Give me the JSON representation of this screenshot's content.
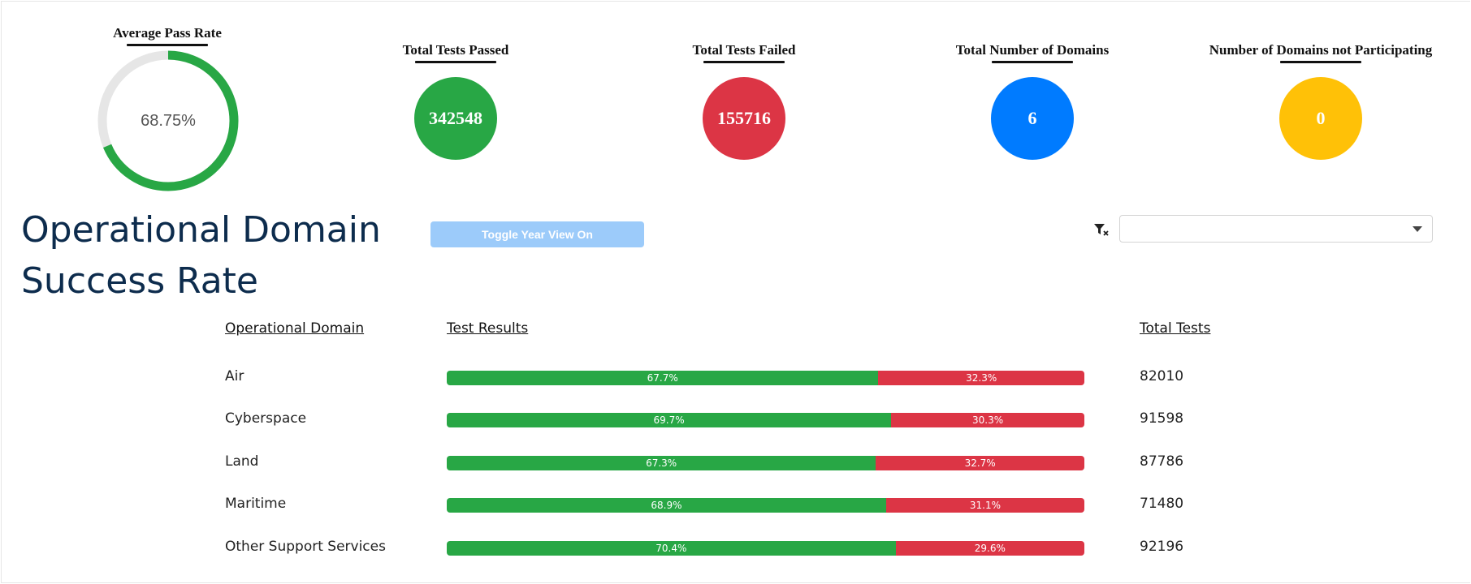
{
  "stats": {
    "avg_pass_rate": {
      "title": "Average Pass Rate",
      "value_text": "68.75%",
      "fraction": 0.6875,
      "fill_color": "#28a745",
      "track_color": "#e6e6e6"
    },
    "passed": {
      "title": "Total Tests Passed",
      "value": "342548",
      "color": "#28a745"
    },
    "failed": {
      "title": "Total Tests Failed",
      "value": "155716",
      "color": "#dc3545"
    },
    "domains": {
      "title": "Total Number of Domains",
      "value": "6",
      "color": "#007bff"
    },
    "not_participating": {
      "title": "Number of Domains not Participating",
      "value": "0",
      "color": "#ffc107"
    }
  },
  "section": {
    "title": "Operational Domain Success Rate",
    "toggle_label": "Toggle Year View On",
    "filter_icon": "filter-clear-icon",
    "select_value": ""
  },
  "table": {
    "headers": {
      "domain": "Operational Domain",
      "results": "Test Results",
      "total": "Total Tests"
    },
    "pass_color": "#28a745",
    "fail_color": "#dc3545",
    "rows": [
      {
        "domain": "Air",
        "pass": 67.7,
        "fail": 32.3,
        "pass_label": "67.7%",
        "fail_label": "32.3%",
        "total": "82010"
      },
      {
        "domain": "Cyberspace",
        "pass": 69.7,
        "fail": 30.3,
        "pass_label": "69.7%",
        "fail_label": "30.3%",
        "total": "91598"
      },
      {
        "domain": "Land",
        "pass": 67.3,
        "fail": 32.7,
        "pass_label": "67.3%",
        "fail_label": "32.7%",
        "total": "87786"
      },
      {
        "domain": "Maritime",
        "pass": 68.9,
        "fail": 31.1,
        "pass_label": "68.9%",
        "fail_label": "31.1%",
        "total": "71480"
      },
      {
        "domain": "Other Support Services",
        "pass": 70.4,
        "fail": 29.6,
        "pass_label": "70.4%",
        "fail_label": "29.6%",
        "total": "92196"
      }
    ]
  }
}
